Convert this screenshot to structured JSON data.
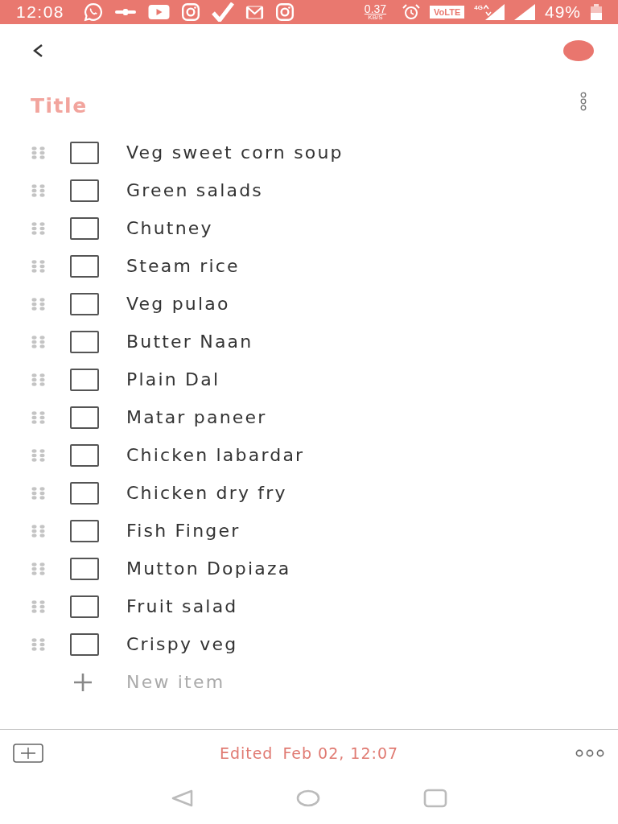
{
  "status_bar": {
    "time": "12:08",
    "data_speed": "0.37",
    "data_speed_unit": "KB/S",
    "volte": "VoLTE",
    "network": "4G",
    "battery": "49%"
  },
  "note": {
    "title": {
      "placeholder": "Title"
    },
    "items": [
      {
        "text": "Veg sweet corn soup",
        "checked": false
      },
      {
        "text": "Green salads",
        "checked": false
      },
      {
        "text": "Chutney",
        "checked": false
      },
      {
        "text": "Steam rice",
        "checked": false
      },
      {
        "text": "Veg pulao",
        "checked": false
      },
      {
        "text": "Butter Naan",
        "checked": false
      },
      {
        "text": "Plain Dal",
        "checked": false
      },
      {
        "text": "Matar paneer",
        "checked": false
      },
      {
        "text": "Chicken labardar",
        "checked": false
      },
      {
        "text": "Chicken dry fry",
        "checked": false
      },
      {
        "text": "Fish Finger",
        "checked": false
      },
      {
        "text": "Mutton Dopiaza",
        "checked": false
      },
      {
        "text": "Fruit salad",
        "checked": false
      },
      {
        "text": "Crispy veg",
        "checked": false
      }
    ],
    "new_item": {
      "placeholder": "New item"
    }
  },
  "footer": {
    "edited_label": "Edited",
    "edited_time": "Feb 02, 12:07"
  }
}
